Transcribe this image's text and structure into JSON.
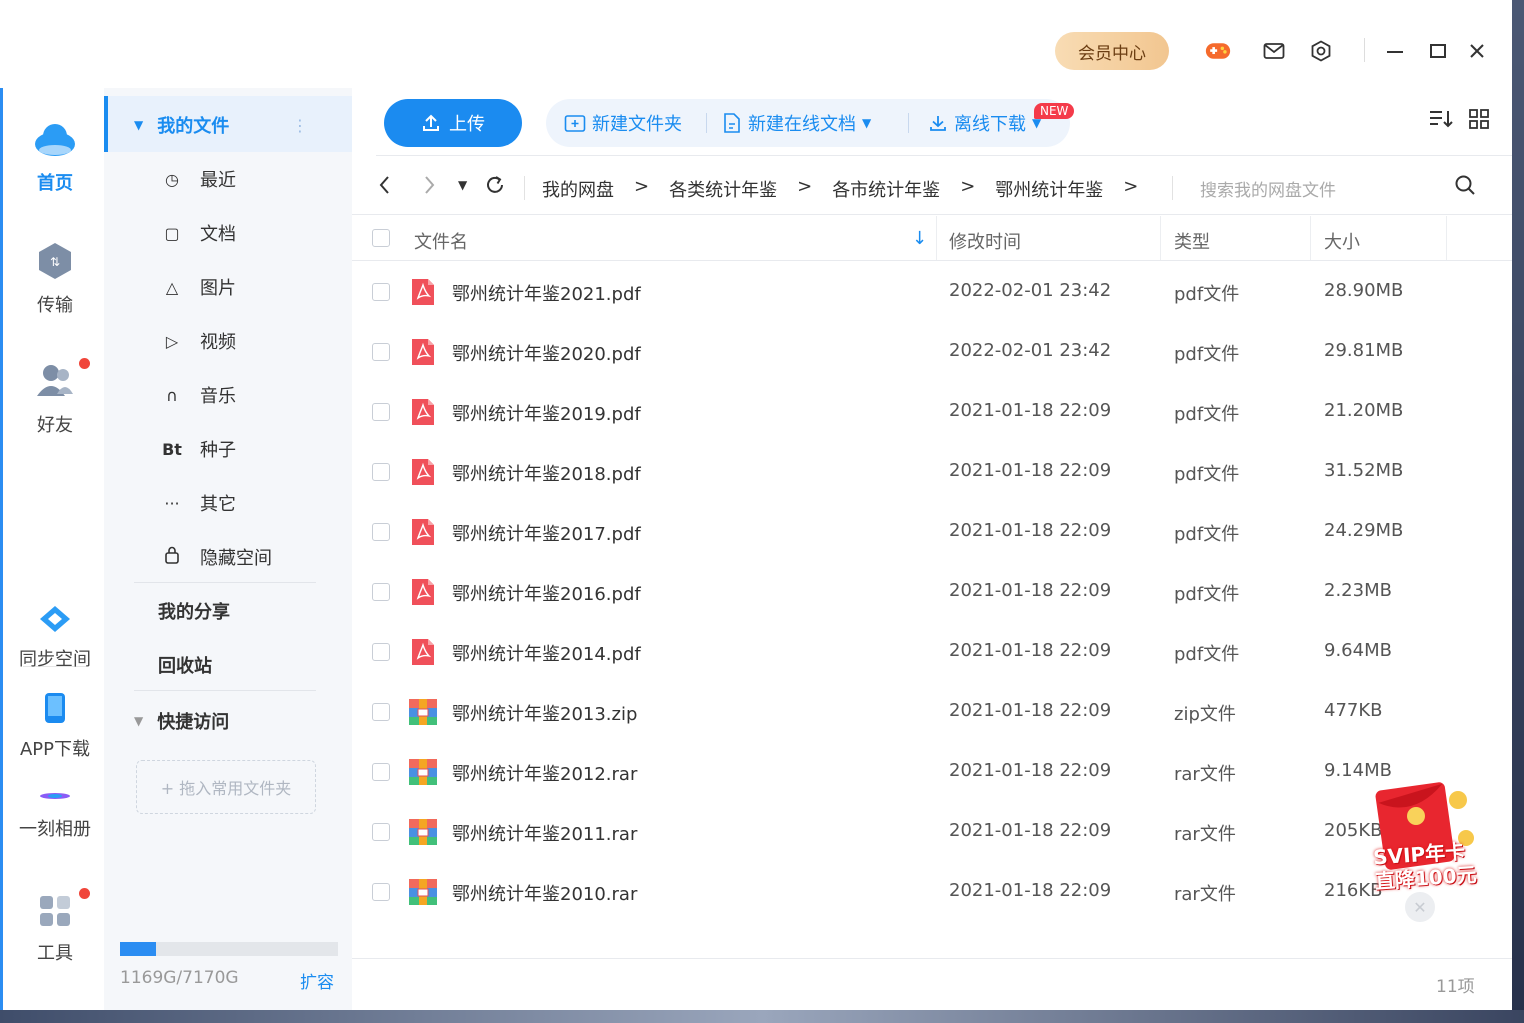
{
  "titlebar": {
    "vip_label": "会员中心"
  },
  "rail": {
    "home": "首页",
    "transfer": "传输",
    "friends": "好友",
    "sync": "同步空间",
    "app": "APP下载",
    "album": "一刻相册",
    "tools": "工具"
  },
  "sidebar": {
    "my_files": "我的文件",
    "recent": "最近",
    "docs": "文档",
    "pictures": "图片",
    "videos": "视频",
    "music": "音乐",
    "torrent": "种子",
    "torrent_icon": "Bt",
    "other": "其它",
    "hidden": "隐藏空间",
    "my_share": "我的分享",
    "recycle": "回收站",
    "quick_access": "快捷访问",
    "drag_hint": "+ 拖入常用文件夹",
    "storage_text": "1169G/7170G",
    "storage_used_fraction": 0.163,
    "expand": "扩容"
  },
  "toolbar": {
    "upload": "上传",
    "new_folder": "新建文件夹",
    "new_online_doc": "新建在线文档",
    "new_badge": "NEW",
    "offline_download": "离线下载"
  },
  "breadcrumb": [
    "我的网盘",
    "各类统计年鉴",
    "各市统计年鉴",
    "鄂州统计年鉴"
  ],
  "search": {
    "placeholder": "搜索我的网盘文件"
  },
  "table": {
    "headers": {
      "name": "文件名",
      "modified": "修改时间",
      "type": "类型",
      "size": "大小"
    },
    "rows": [
      {
        "name": "鄂州统计年鉴2021.pdf",
        "date": "2022-02-01 23:42",
        "type": "pdf文件",
        "size": "28.90MB",
        "kind": "pdf"
      },
      {
        "name": "鄂州统计年鉴2020.pdf",
        "date": "2022-02-01 23:42",
        "type": "pdf文件",
        "size": "29.81MB",
        "kind": "pdf"
      },
      {
        "name": "鄂州统计年鉴2019.pdf",
        "date": "2021-01-18 22:09",
        "type": "pdf文件",
        "size": "21.20MB",
        "kind": "pdf"
      },
      {
        "name": "鄂州统计年鉴2018.pdf",
        "date": "2021-01-18 22:09",
        "type": "pdf文件",
        "size": "31.52MB",
        "kind": "pdf"
      },
      {
        "name": "鄂州统计年鉴2017.pdf",
        "date": "2021-01-18 22:09",
        "type": "pdf文件",
        "size": "24.29MB",
        "kind": "pdf"
      },
      {
        "name": "鄂州统计年鉴2016.pdf",
        "date": "2021-01-18 22:09",
        "type": "pdf文件",
        "size": "2.23MB",
        "kind": "pdf"
      },
      {
        "name": "鄂州统计年鉴2014.pdf",
        "date": "2021-01-18 22:09",
        "type": "pdf文件",
        "size": "9.64MB",
        "kind": "pdf"
      },
      {
        "name": "鄂州统计年鉴2013.zip",
        "date": "2021-01-18 22:09",
        "type": "zip文件",
        "size": "477KB",
        "kind": "zip"
      },
      {
        "name": "鄂州统计年鉴2012.rar",
        "date": "2021-01-18 22:09",
        "type": "rar文件",
        "size": "9.14MB",
        "kind": "rar"
      },
      {
        "name": "鄂州统计年鉴2011.rar",
        "date": "2021-01-18 22:09",
        "type": "rar文件",
        "size": "205KB",
        "kind": "rar"
      },
      {
        "name": "鄂州统计年鉴2010.rar",
        "date": "2021-01-18 22:09",
        "type": "rar文件",
        "size": "216KB",
        "kind": "rar"
      }
    ]
  },
  "footer": {
    "count": "11项"
  },
  "promo": {
    "line1": "SVIP年卡",
    "line2": "直降100元"
  },
  "colors": {
    "accent": "#1b8bf0",
    "pdf": "#f0505a",
    "archive": "#f5a623"
  }
}
